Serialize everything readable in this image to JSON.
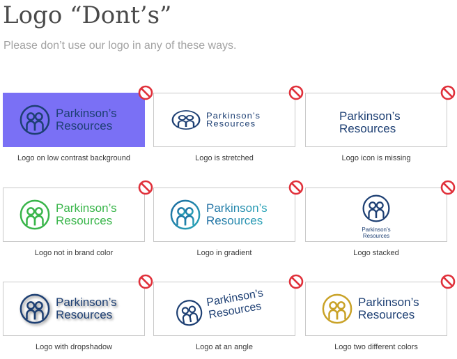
{
  "header": {
    "title": "Logo “Dont’s”",
    "subtitle": "Please don’t use our logo in any of these ways."
  },
  "logo": {
    "line1": "Parkinson’s",
    "line2": "Resources"
  },
  "colors": {
    "brand_navy": "#1d3f73",
    "low_contrast_bg": "#7a70f5",
    "green": "#39b54a",
    "gold": "#c9a227",
    "prohibited_red": "#e0303a"
  },
  "items": [
    {
      "id": "low-contrast",
      "caption": "Logo on low contrast background",
      "icon": "prohibited-icon"
    },
    {
      "id": "stretched",
      "caption": "Logo is stretched",
      "icon": "prohibited-icon"
    },
    {
      "id": "icon-missing",
      "caption": "Logo icon is missing",
      "icon": "prohibited-icon"
    },
    {
      "id": "not-brand-color",
      "caption": "Logo not in brand color",
      "icon": "prohibited-icon"
    },
    {
      "id": "gradient",
      "caption": "Logo in gradient",
      "icon": "prohibited-icon"
    },
    {
      "id": "stacked",
      "caption": "Logo stacked",
      "icon": "prohibited-icon"
    },
    {
      "id": "dropshadow",
      "caption": "Logo with dropshadow",
      "icon": "prohibited-icon"
    },
    {
      "id": "angle",
      "caption": "Logo at an angle",
      "icon": "prohibited-icon"
    },
    {
      "id": "two-colors",
      "caption": "Logo two different colors",
      "icon": "prohibited-icon"
    }
  ]
}
